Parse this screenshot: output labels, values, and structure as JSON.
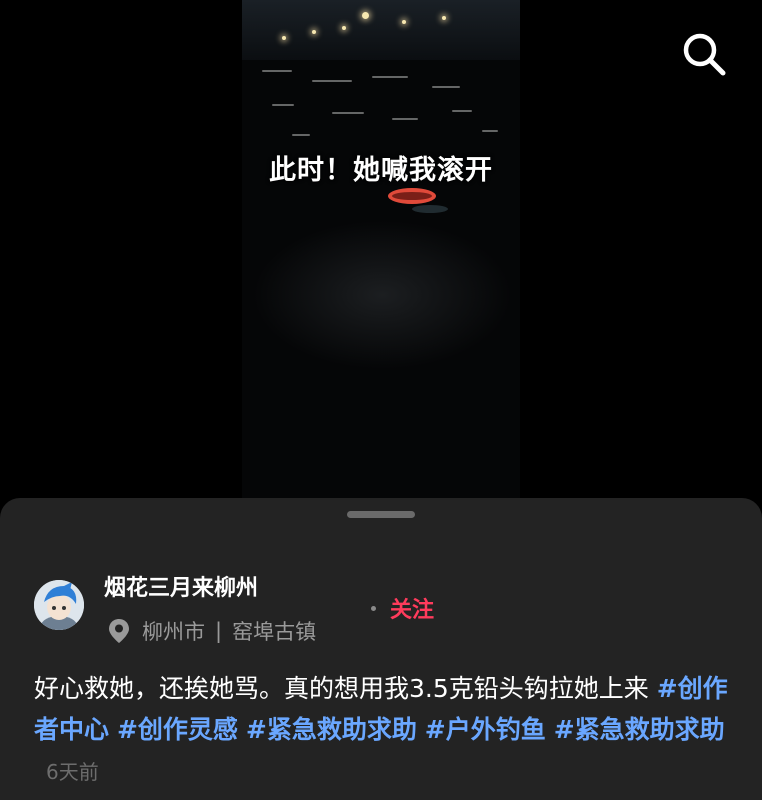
{
  "video": {
    "caption": "此时！她喊我滚开"
  },
  "header": {
    "search_icon": "search-icon"
  },
  "post": {
    "username": "烟花三月来柳州",
    "location_city": "柳州市",
    "location_separator": "|",
    "location_place": "窑埠古镇",
    "follow_label": "关注",
    "description_text": "好心救她，还挨她骂。真的想用我3.5克铅头钩拉她上来 ",
    "hashtags": [
      "#创作者中心",
      "#创作灵感",
      "#紧急救助求助",
      "#户外钓鱼",
      "#紧急救助求助"
    ],
    "timestamp": "6天前"
  },
  "colors": {
    "accent_follow": "#ff3b5c",
    "hashtag": "#6aa7ff",
    "sheet_background": "#232323"
  }
}
